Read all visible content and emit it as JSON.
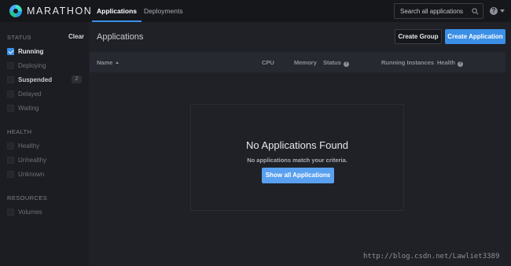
{
  "app": {
    "logo_text": "MARATHON"
  },
  "nav": {
    "tabs": [
      {
        "label": "Applications",
        "active": true
      },
      {
        "label": "Deployments",
        "active": false
      }
    ],
    "search_placeholder": "Search all applications",
    "help_glyph": "?"
  },
  "sidebar": {
    "status": {
      "title": "STATUS",
      "clear_label": "Clear",
      "items": [
        {
          "label": "Running",
          "checked": true
        },
        {
          "label": "Deploying",
          "checked": false
        },
        {
          "label": "Suspended",
          "checked": false,
          "count": "2"
        },
        {
          "label": "Delayed",
          "checked": false
        },
        {
          "label": "Waiting",
          "checked": false
        }
      ]
    },
    "health": {
      "title": "HEALTH",
      "items": [
        {
          "label": "Healthy",
          "checked": false
        },
        {
          "label": "Unhealthy",
          "checked": false
        },
        {
          "label": "Unknown",
          "checked": false
        }
      ]
    },
    "resources": {
      "title": "RESOURCES",
      "items": [
        {
          "label": "Volumes",
          "checked": false
        }
      ]
    }
  },
  "main": {
    "title": "Applications",
    "create_group_label": "Create Group",
    "create_app_label": "Create Application",
    "columns": [
      "Name",
      "CPU",
      "Memory",
      "Status",
      "Running Instances",
      "Health"
    ],
    "empty": {
      "title": "No Applications Found",
      "subtitle": "No applications match your criteria.",
      "button_label": "Show all Applications"
    }
  },
  "watermark": "http://blog.csdn.net/Lawliet3389",
  "colors": {
    "accent": "#3b8fe6",
    "background": "#1f2127",
    "sidebar": "#1b1d22"
  }
}
